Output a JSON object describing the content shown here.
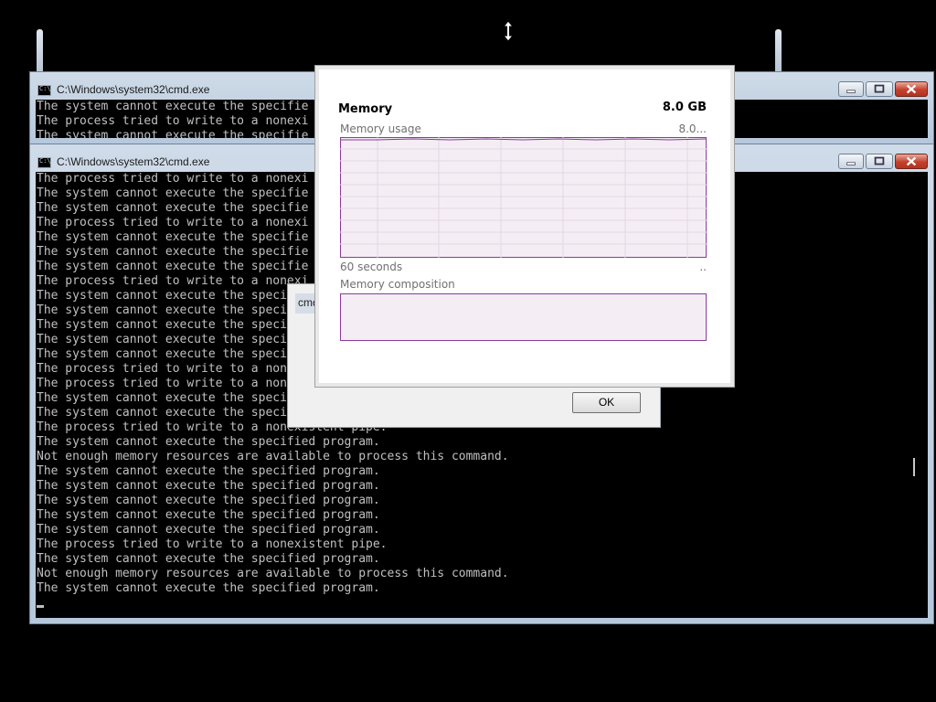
{
  "background": {
    "cursor_icon": "vertical-resize-cursor-icon"
  },
  "cmd_back": {
    "title": "C:\\Windows\\system32\\cmd.exe",
    "icon": "console-icon",
    "lines": [
      "The system cannot execute the specifie",
      "The process tried to write to a nonexi",
      "The system cannot execute the specifie"
    ]
  },
  "cmd_front": {
    "title": "C:\\Windows\\system32\\cmd.exe",
    "icon": "console-icon",
    "lines": [
      "The process tried to write to a nonexi",
      "The system cannot execute the specifie",
      "The system cannot execute the specifie",
      "The process tried to write to a nonexi",
      "The system cannot execute the specifie",
      "The system cannot execute the specifie",
      "The system cannot execute the specifie",
      "The process tried to write to a nonexi",
      "The system cannot execute the speci",
      "The system cannot execute the speci",
      "The system cannot execute the speci",
      "The system cannot execute the speci",
      "The system cannot execute the speci",
      "The process tried to write to a non",
      "The process tried to write to a non",
      "The system cannot execute the speci",
      "The system cannot execute the speci",
      "The process tried to write to a nonexistent pipe.",
      "The system cannot execute the specified program.",
      "Not enough memory resources are available to process this command.",
      "The system cannot execute the specified program.",
      "The system cannot execute the specified program.",
      "The system cannot execute the specified program.",
      "The system cannot execute the specified program.",
      "The system cannot execute the specified program.",
      "The process tried to write to a nonexistent pipe.",
      "The system cannot execute the specified program.",
      "Not enough memory resources are available to process this command.",
      "The system cannot execute the specified program."
    ],
    "colors": {
      "text": "#c0c0c0",
      "background": "#000000"
    }
  },
  "message_box": {
    "title_fragment": "cmd",
    "ok_label": "OK"
  },
  "memory_panel": {
    "title": "Memory",
    "total": "8.0 GB",
    "usage_label": "Memory usage",
    "usage_value": "8.0...",
    "time_label": "60 seconds",
    "time_right": "..",
    "composition_label": "Memory composition",
    "colors": {
      "accent": "#8b3a9c",
      "fill": "#f4eef4",
      "grid": "#e3d6e3"
    }
  }
}
